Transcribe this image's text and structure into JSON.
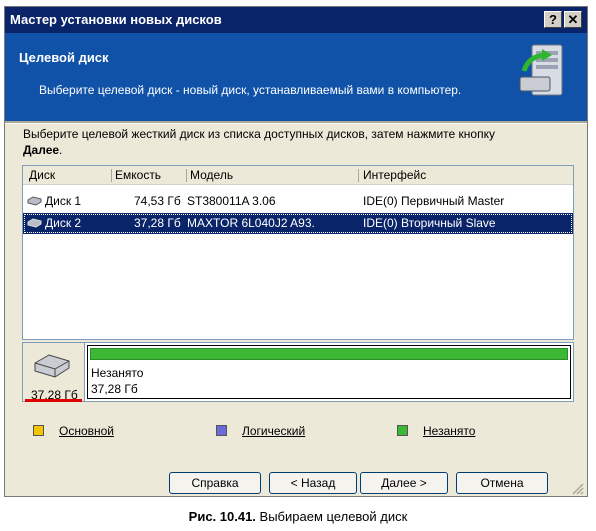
{
  "window": {
    "title": "Мастер установки новых дисков",
    "help_button": "?",
    "close_button": "✕"
  },
  "header": {
    "title": "Целевой диск",
    "subtitle": "Выберите целевой диск - новый диск, устанавливаемый вами в компьютер."
  },
  "instruction": {
    "text": "Выберите целевой жесткий диск из списка доступных дисков, затем нажмите кнопку",
    "bold": "Далее",
    "end": "."
  },
  "table": {
    "columns": [
      "Диск",
      "Емкость",
      "Модель",
      "Интерфейс"
    ],
    "rows": [
      {
        "disk": "Диск 1",
        "capacity": "74,53 Гб",
        "model": "ST380011A 3.06",
        "interface": "IDE(0) Первичный Master",
        "selected": false
      },
      {
        "disk": "Диск 2",
        "capacity": "37,28 Гб",
        "model": "MAXTOR 6L040J2 A93.",
        "interface": "IDE(0) Вторичный Slave",
        "selected": true
      }
    ]
  },
  "disk_map": {
    "size": "37,28 Гб",
    "partition_label": "Незанято",
    "partition_size": "37,28 Гб",
    "partition_color": "#3cb934"
  },
  "legend": [
    {
      "label": "Основной",
      "color": "#f5c400"
    },
    {
      "label": "Логический",
      "color": "#6a6ad8"
    },
    {
      "label": "Незанято",
      "color": "#3cb934"
    }
  ],
  "buttons": {
    "help": "Справка",
    "back": "< Назад",
    "next": "Далее >",
    "cancel": "Отмена"
  },
  "caption": {
    "prefix": "Рис. 10.41.",
    "text": "Выбираем целевой диск"
  }
}
